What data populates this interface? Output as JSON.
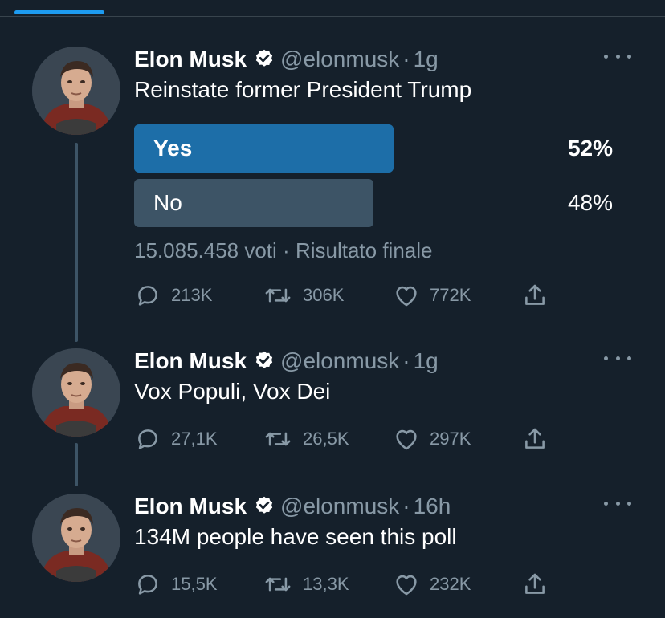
{
  "colors": {
    "background": "#15202b",
    "accent": "#1d9bf0",
    "winner_bar": "#1d6ea8",
    "loser_bar": "#3d5466",
    "muted": "#8899a6"
  },
  "tweets": [
    {
      "author_name": "Elon Musk",
      "handle": "@elonmusk",
      "dot": "·",
      "time": "1g",
      "text": "Reinstate former President Trump",
      "poll": {
        "options": [
          {
            "label": "Yes",
            "percent": "52%",
            "share": 0.52
          },
          {
            "label": "No",
            "percent": "48%",
            "share": 0.48
          }
        ],
        "votes": "15.085.458 voti",
        "separator": "·",
        "status": "Risultato finale"
      },
      "replies": "213K",
      "retweets": "306K",
      "likes": "772K"
    },
    {
      "author_name": "Elon Musk",
      "handle": "@elonmusk",
      "dot": "·",
      "time": "1g",
      "text": "Vox Populi, Vox Dei",
      "replies": "27,1K",
      "retweets": "26,5K",
      "likes": "297K"
    },
    {
      "author_name": "Elon Musk",
      "handle": "@elonmusk",
      "dot": "·",
      "time": "16h",
      "text": "134M people have seen this poll",
      "replies": "15,5K",
      "retweets": "13,3K",
      "likes": "232K"
    }
  ]
}
